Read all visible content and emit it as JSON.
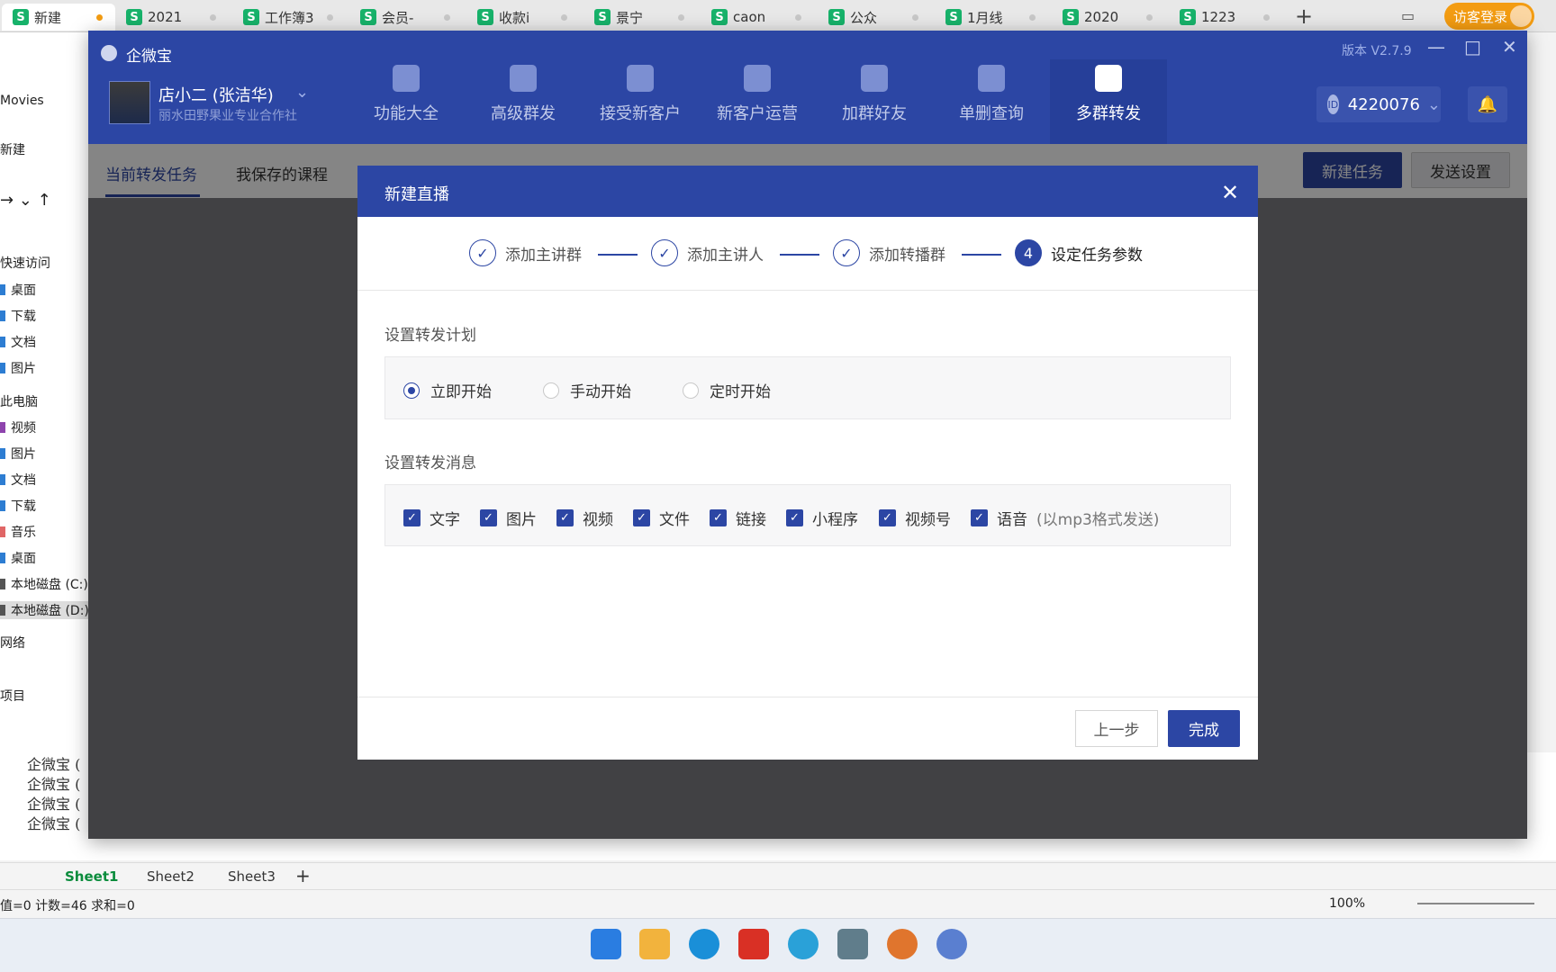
{
  "browser_tabs": [
    {
      "label": "新建 ",
      "active": true
    },
    {
      "label": "2021"
    },
    {
      "label": "工作簿3"
    },
    {
      "label": "会员-"
    },
    {
      "label": "收款i"
    },
    {
      "label": "景宁"
    },
    {
      "label": "caon"
    },
    {
      "label": "公众"
    },
    {
      "label": "1月线"
    },
    {
      "label": "2020"
    },
    {
      "label": "1223"
    }
  ],
  "tab_icon_letter": "S",
  "visitor_login": "访客登录",
  "explorer": {
    "movies": "Movies",
    "new": "新建",
    "quick_access": "快速访问",
    "items": [
      "桌面",
      "下载",
      "文档",
      "图片"
    ],
    "this_pc": "此电脑",
    "pc_items": [
      "视频",
      "图片",
      "文档",
      "下载",
      "音乐",
      "桌面",
      "本地磁盘 (C:)",
      "本地磁盘 (D:)"
    ],
    "network": "网络",
    "project": "项目"
  },
  "sheet": {
    "rows": [
      "企微宝 (",
      "企微宝 (",
      "企微宝 (",
      "企微宝 ("
    ],
    "tabs": [
      "Sheet1",
      "Sheet2",
      "Sheet3"
    ],
    "status": "值=0  计数=46  求和=0",
    "zoom": "100%"
  },
  "app": {
    "title": "企微宝",
    "version": "版本 V2.7.9",
    "user_name": "店小二 (张洁华)",
    "user_company": "丽水田野果业专业合作社",
    "nav": [
      "功能大全",
      "高级群发",
      "接受新客户",
      "新客户运营",
      "加群好友",
      "单删查询",
      "多群转发"
    ],
    "id_label": "ID",
    "id_value": "4220076",
    "subtabs": [
      "当前转发任务",
      "我保存的课程"
    ],
    "new_task": "新建任务",
    "send_settings": "发送设置"
  },
  "modal": {
    "title": "新建直播",
    "steps": [
      {
        "label": "添加主讲群",
        "done": true
      },
      {
        "label": "添加主讲人",
        "done": true
      },
      {
        "label": "添加转播群",
        "done": true
      },
      {
        "label": "设定任务参数",
        "num": "4"
      }
    ],
    "check_glyph": "✓",
    "plan_label": "设置转发计划",
    "plan_options": [
      {
        "label": "立即开始",
        "selected": true
      },
      {
        "label": "手动开始",
        "selected": false
      },
      {
        "label": "定时开始",
        "selected": false
      }
    ],
    "msg_label": "设置转发消息",
    "msg_options": [
      {
        "label": "文字",
        "checked": true
      },
      {
        "label": "图片",
        "checked": true
      },
      {
        "label": "视频",
        "checked": true
      },
      {
        "label": "文件",
        "checked": true
      },
      {
        "label": "链接",
        "checked": true
      },
      {
        "label": "小程序",
        "checked": true
      },
      {
        "label": "视频号",
        "checked": true
      },
      {
        "label": "语音",
        "checked": true,
        "note": "(以mp3格式发送)"
      }
    ],
    "prev_button": "上一步",
    "done_button": "完成"
  },
  "colors": {
    "brand": "#2c46a4",
    "visitor": "#f39c12",
    "sheet_green": "#17b26a"
  }
}
